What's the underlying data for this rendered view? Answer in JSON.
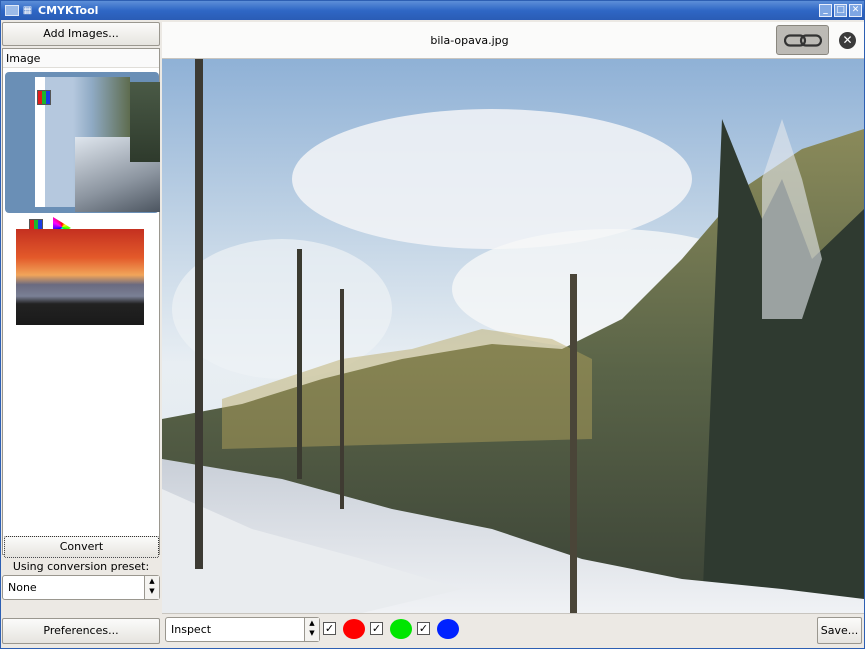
{
  "window": {
    "title": "CMYKTool"
  },
  "left": {
    "add_images": "Add Images...",
    "list_header": "Image",
    "convert": "Convert",
    "preset_label": "Using conversion preset:",
    "preset_value": "None",
    "preferences": "Preferences..."
  },
  "viewer": {
    "filename": "bila-opava.jpg"
  },
  "bottom": {
    "inspect_value": "Inspect",
    "save": "Save...",
    "channels": [
      {
        "name": "red",
        "checked": true,
        "color": "#ff0000"
      },
      {
        "name": "green",
        "checked": true,
        "color": "#00e600"
      },
      {
        "name": "blue",
        "checked": true,
        "color": "#0022ff"
      }
    ]
  },
  "colors": {
    "titlebar": "#2f67c5",
    "selection": "#6a8fb6"
  }
}
